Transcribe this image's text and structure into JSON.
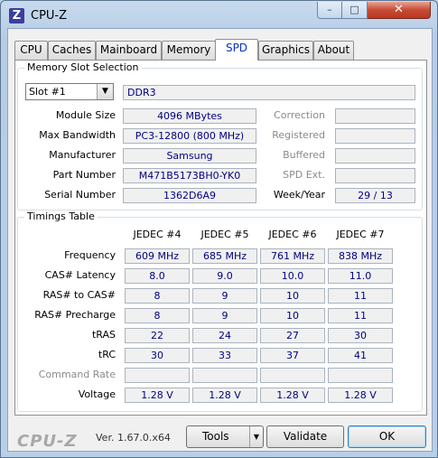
{
  "window": {
    "icon": "Z",
    "title": "CPU-Z",
    "min": "–",
    "max": "□",
    "close": "✕"
  },
  "tabs": [
    {
      "label": "CPU"
    },
    {
      "label": "Caches"
    },
    {
      "label": "Mainboard"
    },
    {
      "label": "Memory"
    },
    {
      "label": "SPD",
      "active": true
    },
    {
      "label": "Graphics"
    },
    {
      "label": "About"
    }
  ],
  "slot": {
    "group_title": "Memory Slot Selection",
    "selected": "Slot #1",
    "type": "DDR3",
    "rows": [
      {
        "label": "Module Size",
        "value": "4096 MBytes",
        "right_label": "Correction",
        "right_value": ""
      },
      {
        "label": "Max Bandwidth",
        "value": "PC3-12800 (800 MHz)",
        "right_label": "Registered",
        "right_value": ""
      },
      {
        "label": "Manufacturer",
        "value": "Samsung",
        "right_label": "Buffered",
        "right_value": ""
      },
      {
        "label": "Part Number",
        "value": "M471B5173BH0-YK0",
        "right_label": "SPD Ext.",
        "right_value": ""
      },
      {
        "label": "Serial Number",
        "value": "1362D6A9",
        "right_label": "Week/Year",
        "right_value": "29 / 13"
      }
    ]
  },
  "timings": {
    "group_title": "Timings Table",
    "columns": [
      "JEDEC #4",
      "JEDEC #5",
      "JEDEC #6",
      "JEDEC #7"
    ],
    "rows": [
      {
        "label": "Frequency",
        "values": [
          "609 MHz",
          "685 MHz",
          "761 MHz",
          "838 MHz"
        ]
      },
      {
        "label": "CAS# Latency",
        "values": [
          "8.0",
          "9.0",
          "10.0",
          "11.0"
        ]
      },
      {
        "label": "RAS# to CAS#",
        "values": [
          "8",
          "9",
          "10",
          "11"
        ]
      },
      {
        "label": "RAS# Precharge",
        "values": [
          "8",
          "9",
          "10",
          "11"
        ]
      },
      {
        "label": "tRAS",
        "values": [
          "22",
          "24",
          "27",
          "30"
        ]
      },
      {
        "label": "tRC",
        "values": [
          "30",
          "33",
          "37",
          "41"
        ]
      },
      {
        "label": "Command Rate",
        "values": [
          "",
          "",
          "",
          ""
        ],
        "dim": true
      },
      {
        "label": "Voltage",
        "values": [
          "1.28 V",
          "1.28 V",
          "1.28 V",
          "1.28 V"
        ]
      }
    ]
  },
  "footer": {
    "logo": "CPU-Z",
    "version": "Ver. 1.67.0.x64",
    "tools": "Tools",
    "tools_arrow": "▼",
    "validate": "Validate",
    "ok": "OK"
  },
  "colors": {
    "value_text": "#000080",
    "close_button": "#c74a35",
    "active_tab_text": "#0033cc"
  }
}
